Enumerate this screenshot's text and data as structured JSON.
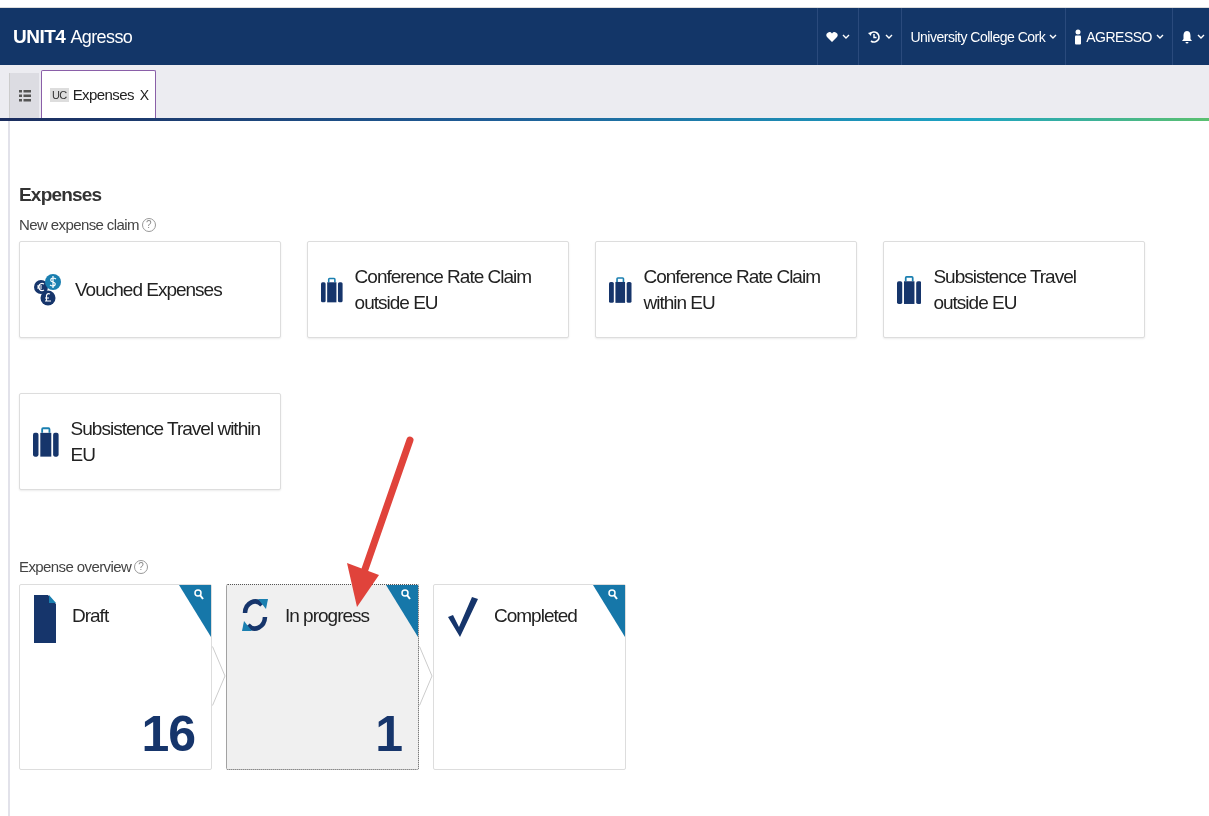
{
  "header": {
    "logo": "UNIT4",
    "product": "Agresso",
    "company": "University College Cork",
    "user": "AGRESSO"
  },
  "tabs": [
    {
      "badge": "UC",
      "label": "Expenses",
      "close": "X",
      "selected": true
    }
  ],
  "page": {
    "title": "Expenses"
  },
  "new_claim": {
    "heading": "New expense claim",
    "help": "?",
    "items": [
      {
        "kind": "currency",
        "label": "Vouched Expenses"
      },
      {
        "kind": "suitcase",
        "label": "Conference Rate Claim outside EU"
      },
      {
        "kind": "suitcase",
        "label": "Conference Rate Claim within EU"
      },
      {
        "kind": "suitcase",
        "label": "Subsistence Travel outside EU"
      },
      {
        "kind": "suitcase",
        "label": "Subsistence Travel within EU"
      }
    ]
  },
  "overview": {
    "heading": "Expense overview",
    "help": "?",
    "tiles": [
      {
        "kind": "draft",
        "label": "Draft",
        "count": "16",
        "selected": false
      },
      {
        "kind": "progress",
        "label": "In progress",
        "count": "1",
        "selected": true
      },
      {
        "kind": "completed",
        "label": "Completed",
        "selected": false
      }
    ]
  }
}
